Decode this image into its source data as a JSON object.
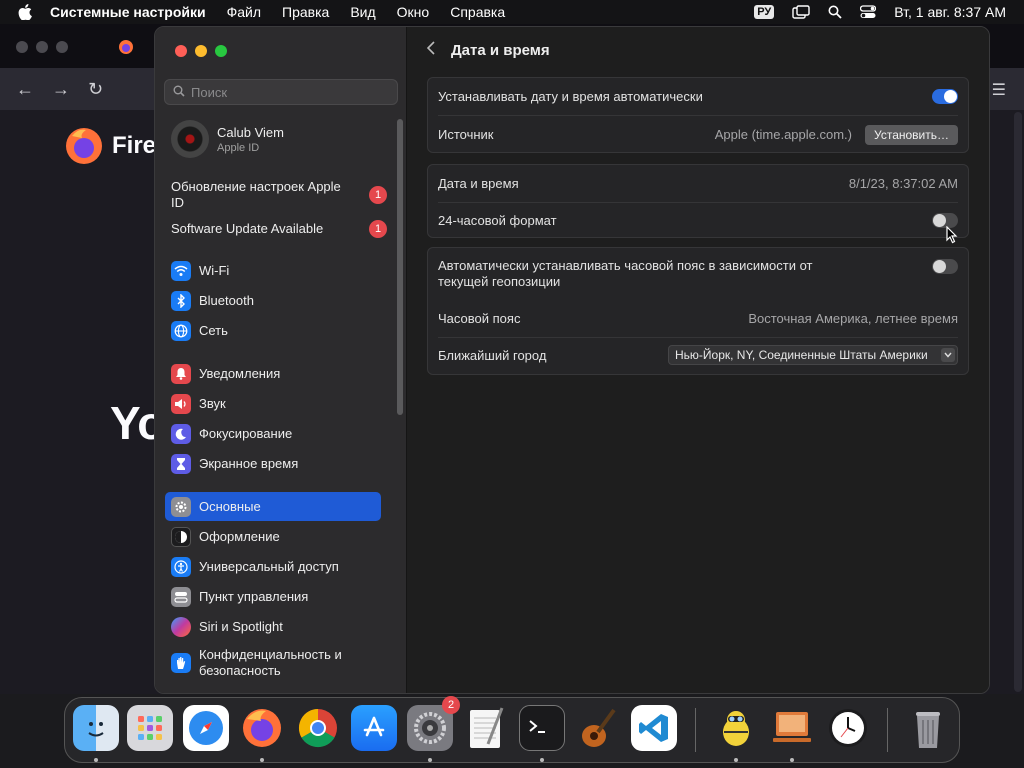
{
  "menubar": {
    "app_name": "Системные настройки",
    "items": [
      "Файл",
      "Правка",
      "Вид",
      "Окно",
      "Справка"
    ],
    "input_source": "РУ",
    "datetime": "Вт, 1 авг.  8:37 AM"
  },
  "firefox": {
    "brand": "Fire",
    "heading": "Yo"
  },
  "sidebar": {
    "search_placeholder": "Поиск",
    "account_name": "Calub Viem",
    "account_sub": "Apple ID",
    "updates": [
      {
        "label": "Обновление настроек Apple ID",
        "badge": "1"
      },
      {
        "label": "Software Update Available",
        "badge": "1"
      }
    ],
    "items": [
      {
        "label": "Wi-Fi",
        "color": "#1a7cf5"
      },
      {
        "label": "Bluetooth",
        "color": "#1a7cf5"
      },
      {
        "label": "Сеть",
        "color": "#1a7cf5"
      },
      {
        "label": "Уведомления",
        "color": "#e5484d"
      },
      {
        "label": "Звук",
        "color": "#e5484d"
      },
      {
        "label": "Фокусирование",
        "color": "#5e5ce6"
      },
      {
        "label": "Экранное время",
        "color": "#5e5ce6"
      },
      {
        "label": "Основные",
        "color": "#8e8e93"
      },
      {
        "label": "Оформление",
        "color": "#1c1c1e"
      },
      {
        "label": "Универсальный доступ",
        "color": "#1a7cf5"
      },
      {
        "label": "Пункт управления",
        "color": "#8e8e93"
      },
      {
        "label": "Siri и Spotlight",
        "color": "#c03aa0"
      },
      {
        "label": "Конфиденциальность и безопасность",
        "color": "#1a7cf5"
      }
    ],
    "selected": "Основные"
  },
  "content": {
    "title": "Дата и время",
    "group1": {
      "auto_label": "Устанавливать дату и время автоматически",
      "auto_on": true,
      "source_label": "Источник",
      "source_value": "Apple (time.apple.com.)",
      "set_button": "Установить…"
    },
    "group2": {
      "datetime_label": "Дата и время",
      "datetime_value": "8/1/23, 8:37:02 AM",
      "format_label": "24-часовой формат",
      "format_on": false
    },
    "group3": {
      "auto_tz_label": "Автоматически устанавливать часовой пояс в зависимости от текущей геопозиции",
      "auto_tz_on": false,
      "tz_label": "Часовой пояс",
      "tz_value": "Восточная Америка, летнее время",
      "city_label": "Ближайший город",
      "city_value": "Нью-Йорк, NY, Соединенные Штаты Америки"
    },
    "help": "?"
  },
  "dock": {
    "apps": [
      "Finder",
      "Launchpad",
      "Safari",
      "Firefox",
      "Chrome",
      "App Store",
      "System Settings",
      "TextEdit",
      "Terminal",
      "GarageBand",
      "VS Code",
      "Cyberduck",
      "Remote Desktop",
      "Clock",
      "Trash"
    ],
    "settings_badge": "2"
  }
}
